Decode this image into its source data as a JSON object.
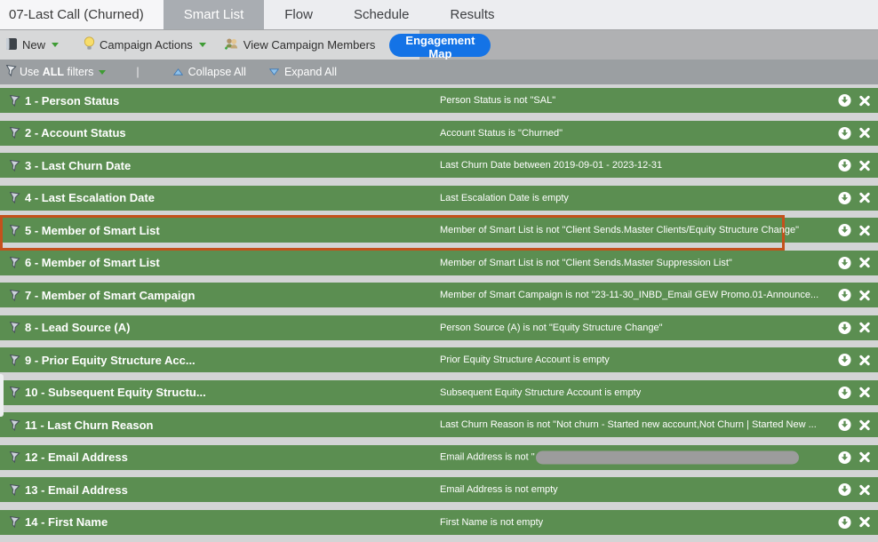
{
  "tabs": {
    "campaign_name": "07-Last Call (Churned)",
    "items": [
      {
        "label": "Smart List",
        "active": true
      },
      {
        "label": "Flow",
        "active": false
      },
      {
        "label": "Schedule",
        "active": false
      },
      {
        "label": "Results",
        "active": false
      }
    ]
  },
  "toolbar": {
    "new_label": "New",
    "campaign_actions_label": "Campaign Actions",
    "view_campaign_members_label": "View Campaign Members",
    "engagement_map_label": "Engagement Map"
  },
  "filter_bar": {
    "use_pre": "Use",
    "use_all": "ALL",
    "use_post": "filters",
    "divider": "|",
    "collapse_all": "Collapse All",
    "expand_all": "Expand All"
  },
  "filters": [
    {
      "title": "1 - Person Status",
      "desc": "Person Status is not \"SAL\""
    },
    {
      "title": "2 - Account Status",
      "desc": "Account Status is \"Churned\""
    },
    {
      "title": "3 - Last Churn Date",
      "desc": "Last Churn Date between 2019-09-01 - 2023-12-31"
    },
    {
      "title": "4 - Last Escalation Date",
      "desc": "Last Escalation Date is empty"
    },
    {
      "title": "5 - Member of Smart List",
      "desc": "Member of Smart List is not \"Client Sends.Master Clients/Equity Structure Change\"",
      "highlighted": true
    },
    {
      "title": "6 - Member of Smart List",
      "desc": "Member of Smart List is not \"Client Sends.Master Suppression List\""
    },
    {
      "title": "7 - Member of Smart Campaign",
      "desc": "Member of Smart Campaign is not \"23-11-30_INBD_Email GEW Promo.01-Announce..."
    },
    {
      "title": "8 - Lead Source (A)",
      "desc": "Person Source (A) is not \"Equity Structure Change\""
    },
    {
      "title": "9 - Prior Equity Structure Acc...",
      "desc": "Prior Equity Structure Account is empty"
    },
    {
      "title": "10 - Subsequent Equity Structu...",
      "desc": "Subsequent Equity Structure Account is empty"
    },
    {
      "title": "11 - Last Churn Reason",
      "desc": "Last Churn Reason is not \"Not churn - Started new account,Not Churn | Started New ..."
    },
    {
      "title": "12 - Email Address",
      "desc": "Email Address is not \"",
      "redacted": true
    },
    {
      "title": "13 - Email Address",
      "desc": "Email Address is not empty"
    },
    {
      "title": "14 - First Name",
      "desc": "First Name is not empty"
    }
  ],
  "icons": {
    "row_left": "filter-funnel-icon",
    "row_actions": [
      "download-circle-icon",
      "remove-x-icon"
    ],
    "toolbar": [
      "new-doc-icon",
      "lightbulb-icon",
      "group-members-icon",
      "caret-down-icon"
    ],
    "filter_bar": [
      "filter-funnel-icon",
      "caret-down-icon",
      "triangle-up-icon",
      "triangle-down-icon"
    ]
  },
  "colors": {
    "row_green": "#5b8e51",
    "gap_gray": "#d3d4d5",
    "filter_bar_gray": "#9b9fa2",
    "toolbar_gray": "#d7d8d9",
    "toolbar_right_gray": "#b0b1b3",
    "active_tab_gray": "#a9adb2",
    "engagement_blue": "#1473e6",
    "highlight_orange": "#c4511c",
    "redaction_gray": "#9c9c9c"
  }
}
